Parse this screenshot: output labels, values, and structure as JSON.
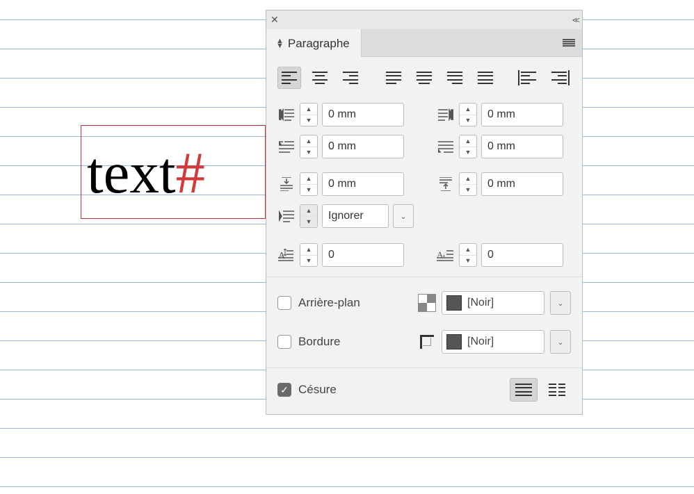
{
  "canvas": {
    "text": "text",
    "marker": "#"
  },
  "panel": {
    "tab_label": "Paragraphe",
    "indent_left": "0 mm",
    "indent_right": "0 mm",
    "first_line": "0 mm",
    "last_line": "0 mm",
    "space_before": "0 mm",
    "space_after": "0 mm",
    "span_mode": "Ignorer",
    "dropcap_lines": "0",
    "dropcap_chars": "0",
    "bg_label": "Arrière-plan",
    "bg_color": "[Noir]",
    "border_label": "Bordure",
    "border_color": "[Noir]",
    "hyphen_label": "Césure"
  }
}
